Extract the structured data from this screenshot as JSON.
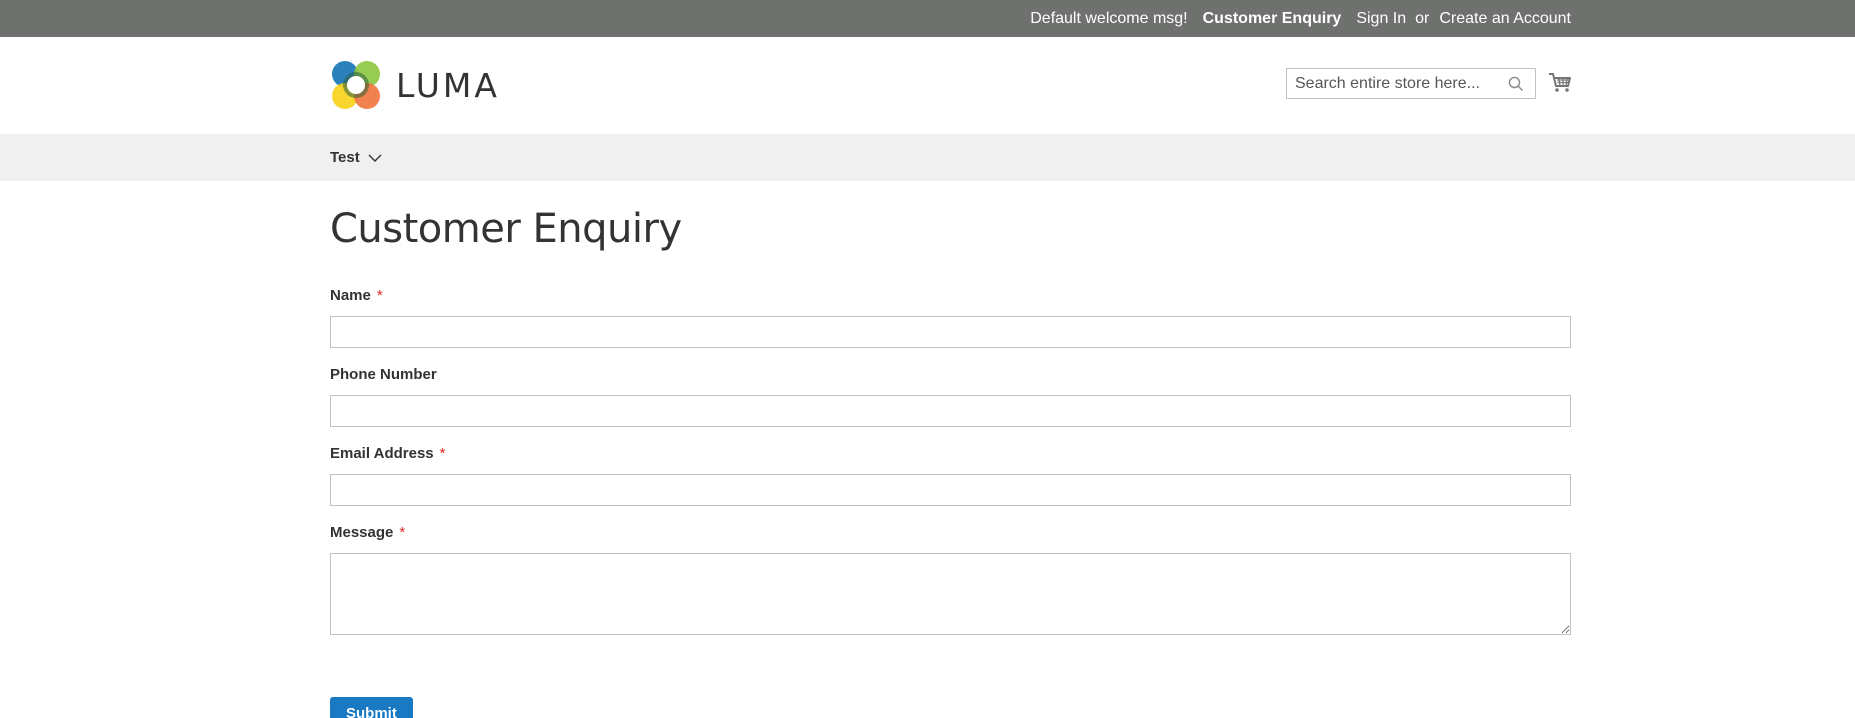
{
  "topbar": {
    "welcome": "Default welcome msg!",
    "enquiry_link": "Customer Enquiry",
    "sign_in": "Sign In",
    "or": "or",
    "create_account": "Create an Account"
  },
  "header": {
    "logo_text": "LUMA",
    "search_placeholder": "Search entire store here...",
    "search_value": ""
  },
  "nav": {
    "items": [
      {
        "label": "Test"
      }
    ]
  },
  "page": {
    "title": "Customer Enquiry"
  },
  "form": {
    "name_label": "Name",
    "phone_label": "Phone Number",
    "email_label": "Email Address",
    "message_label": "Message",
    "required_mark": "*",
    "name_value": "",
    "phone_value": "",
    "email_value": "",
    "message_value": "",
    "submit_label": "Submit"
  },
  "colors": {
    "topbar_bg": "#6e716e",
    "nav_bg": "#f0f0f0",
    "primary_button": "#1979c3",
    "required": "#e02b27"
  },
  "icons": {
    "search": "search-icon",
    "cart": "cart-icon",
    "chevron": "chevron-down-icon"
  }
}
